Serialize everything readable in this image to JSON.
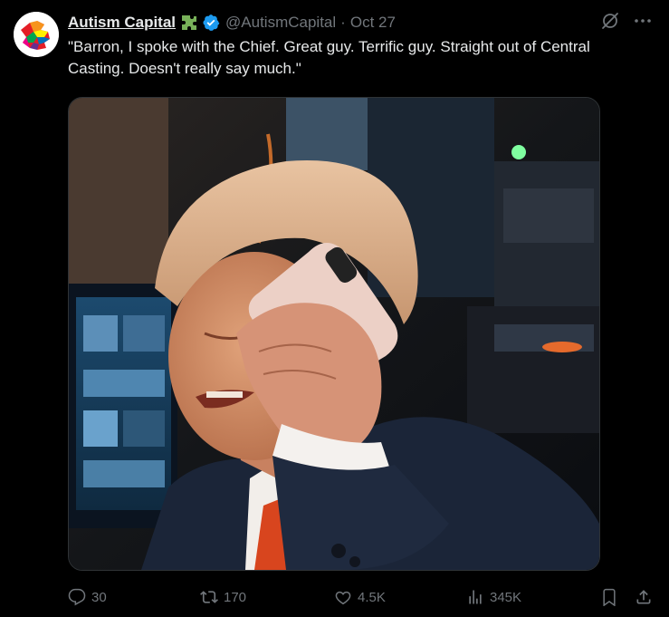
{
  "author": {
    "display_name": "Autism Capital",
    "emoji": "jigsaw-puzzle-emoji",
    "verified": true,
    "handle": "@AutismCapital",
    "separator": "·",
    "date": "Oct 27"
  },
  "tweet": {
    "text": "\"Barron, I spoke with the Chief. Great guy. Terrific guy. Straight out of Central Casting. Doesn't really say much.\""
  },
  "media": {
    "type": "video-still",
    "subject": "man in dark suit with white shirt and red tie holding a pink phone to his ear in a dim control room with monitors and mixing desk"
  },
  "actions": {
    "replies": "30",
    "reposts": "170",
    "likes": "4.5K",
    "views": "345K"
  },
  "colors": {
    "background": "#000000",
    "text": "#e7e9ea",
    "muted": "#71767b",
    "verified": "#1d9bf0",
    "border": "#2f3336"
  }
}
